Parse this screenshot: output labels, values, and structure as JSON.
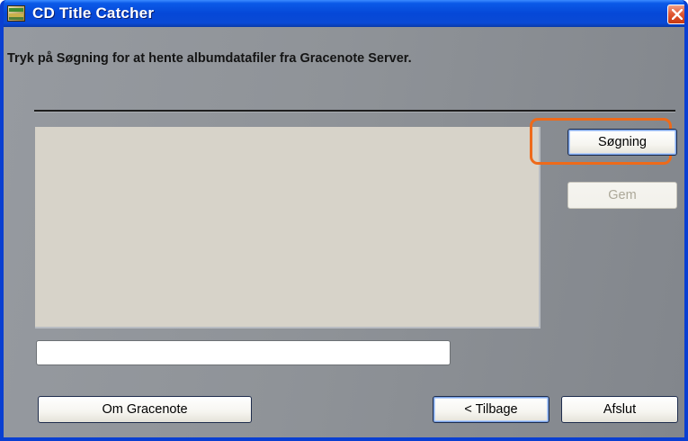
{
  "window": {
    "title": "CD Title Catcher",
    "close_icon": "close-icon",
    "app_icon": "cd-title-catcher-app-icon"
  },
  "main": {
    "instruction": "Tryk på Søgning for at hente albumdatafiler fra Gracenote Server.",
    "progress_field_value": ""
  },
  "buttons": {
    "search": {
      "label": "Søgning",
      "state": "focused"
    },
    "save": {
      "label": "Gem",
      "state": "disabled"
    },
    "about": {
      "label": "Om Gracenote"
    },
    "back": {
      "label": "< Tilbage"
    },
    "exit": {
      "label": "Afslut"
    }
  },
  "colors": {
    "titlebar_blue": "#0548d7",
    "client_gray": "#8f9398",
    "results_pane": "#d7d3c9",
    "highlight_orange": "#ee6a1a",
    "close_red": "#e15a36"
  }
}
